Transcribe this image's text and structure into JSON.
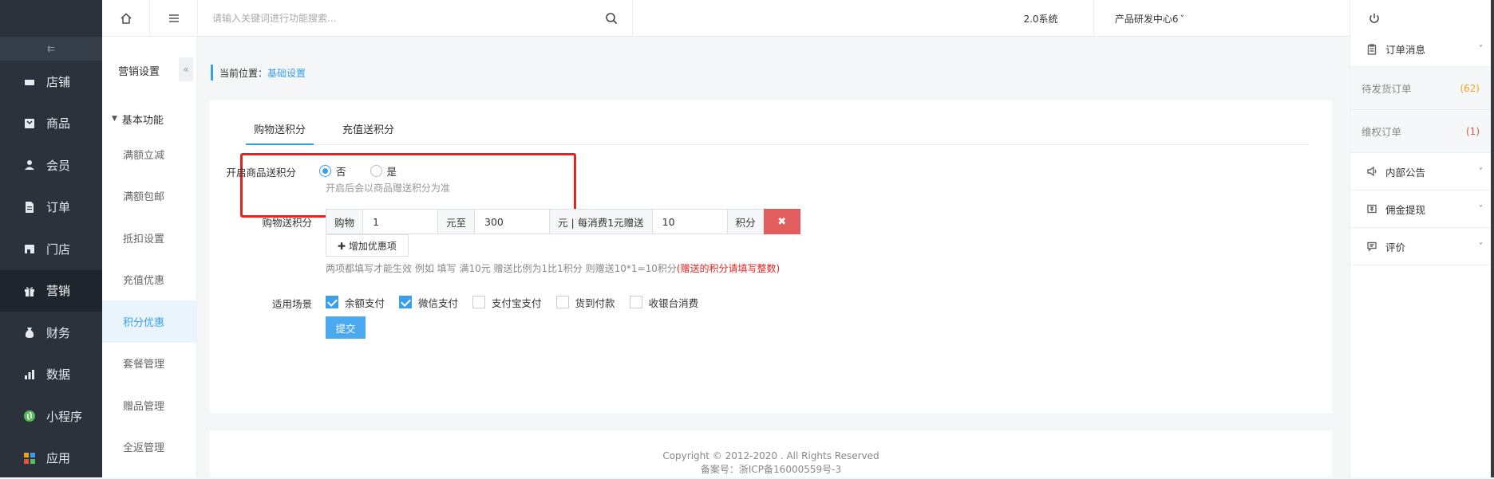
{
  "sidebar": {
    "collapse_icon": "collapse-list-icon",
    "items": [
      {
        "label": "店铺",
        "icon": "store-icon"
      },
      {
        "label": "商品",
        "icon": "goods-icon"
      },
      {
        "label": "会员",
        "icon": "user-icon"
      },
      {
        "label": "订单",
        "icon": "order-icon"
      },
      {
        "label": "门店",
        "icon": "shop-icon"
      },
      {
        "label": "营销",
        "icon": "gift-icon",
        "active": true
      },
      {
        "label": "财务",
        "icon": "money-bag-icon"
      },
      {
        "label": "数据",
        "icon": "bar-chart-icon"
      },
      {
        "label": "小程序",
        "icon": "mini-program-icon"
      },
      {
        "label": "应用",
        "icon": "apps-icon"
      }
    ]
  },
  "subnav": {
    "title": "营销设置",
    "collapse": "«",
    "group": "基本功能",
    "items": [
      {
        "label": "满额立减"
      },
      {
        "label": "满额包邮"
      },
      {
        "label": "抵扣设置"
      },
      {
        "label": "充值优惠"
      },
      {
        "label": "积分优惠",
        "active": true
      },
      {
        "label": "套餐管理"
      },
      {
        "label": "赠品管理"
      },
      {
        "label": "全返管理"
      }
    ]
  },
  "topbar": {
    "search_placeholder": "请输入关键词进行功能搜索...",
    "version": "2.0系统",
    "org": "产品研发中心6",
    "org_caret": "˅"
  },
  "breadcrumb": {
    "prefix": "当前位置：",
    "current": "基础设置"
  },
  "tabs": [
    {
      "label": "购物送积分",
      "active": true
    },
    {
      "label": "充值送积分"
    }
  ],
  "form": {
    "enable_label": "开启商品送积分",
    "radio_no": "否",
    "radio_yes": "是",
    "selected": "否",
    "enable_hint": "开启后会以商品赠送积分为准",
    "shopping_label": "购物送积分",
    "shop_prefix": "购物",
    "amount_from": "1",
    "amount_to_label": "元至",
    "amount_to": "300",
    "per_label": "元 | 每消费1元赠送",
    "points_value": "10",
    "points_unit": "积分",
    "delete": "✖",
    "add_label": "✚ 增加优惠项",
    "note": "两项都填写才能生效 例如 填写 满10元 赠送比例为1比1积分 则赠送10*1=10积分",
    "note_red": "(赠送的积分请填写整数)",
    "scene_label": "适用场景",
    "scenes": [
      {
        "label": "余额支付",
        "checked": true
      },
      {
        "label": "微信支付",
        "checked": true
      },
      {
        "label": "支付宝支付",
        "checked": false
      },
      {
        "label": "货到付款",
        "checked": false
      },
      {
        "label": "收银台消费",
        "checked": false
      }
    ],
    "submit": "提交"
  },
  "footer": {
    "copyright": "Copyright © 2012-2020 . All Rights Reserved",
    "icp": "备案号：浙ICP备16000559号-3"
  },
  "rpanel": {
    "order_msg": "订单消息",
    "pending_ship": "待发货订单",
    "pending_ship_count": "(62)",
    "rights_order": "维权订单",
    "rights_order_count": "(1)",
    "notice": "内部公告",
    "commission": "佣金提现",
    "review": "评价",
    "chevron": "˅"
  }
}
